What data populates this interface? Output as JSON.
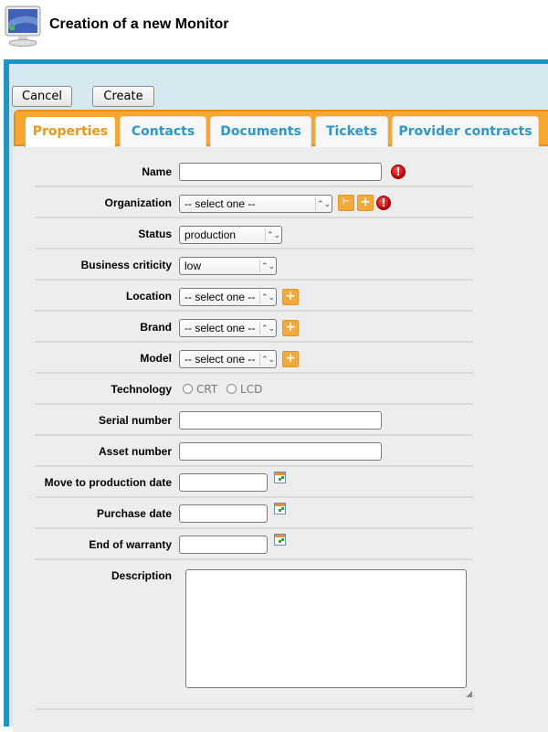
{
  "header": {
    "title": "Creation of a new Monitor",
    "icon": "monitor-icon"
  },
  "toolbar": {
    "cancel_label": "Cancel",
    "create_label": "Create"
  },
  "tabs": [
    {
      "label": "Properties",
      "active": true
    },
    {
      "label": "Contacts",
      "active": false
    },
    {
      "label": "Documents",
      "active": false
    },
    {
      "label": "Tickets",
      "active": false
    },
    {
      "label": "Provider contracts",
      "active": false
    }
  ],
  "form": {
    "name": {
      "label": "Name",
      "value": "",
      "required": true
    },
    "organization": {
      "label": "Organization",
      "value": "-- select one --",
      "required": true
    },
    "status": {
      "label": "Status",
      "value": "production"
    },
    "business_criticity": {
      "label": "Business criticity",
      "value": "low"
    },
    "location": {
      "label": "Location",
      "value": "-- select one --"
    },
    "brand": {
      "label": "Brand",
      "value": "-- select one --"
    },
    "model": {
      "label": "Model",
      "value": "-- select one --"
    },
    "technology": {
      "label": "Technology",
      "options": [
        "CRT",
        "LCD"
      ],
      "selected": null
    },
    "serial_number": {
      "label": "Serial number",
      "value": ""
    },
    "asset_number": {
      "label": "Asset number",
      "value": ""
    },
    "move_to_production_date": {
      "label": "Move to production date",
      "value": ""
    },
    "purchase_date": {
      "label": "Purchase date",
      "value": ""
    },
    "end_of_warranty": {
      "label": "End of warranty",
      "value": ""
    },
    "description": {
      "label": "Description",
      "value": ""
    }
  },
  "colors": {
    "accent_blue": "#1e95c6",
    "tab_orange": "#f5a732",
    "active_tab_text": "#ef9615",
    "tab_text": "#2a98cc",
    "error_red": "#c40000"
  }
}
